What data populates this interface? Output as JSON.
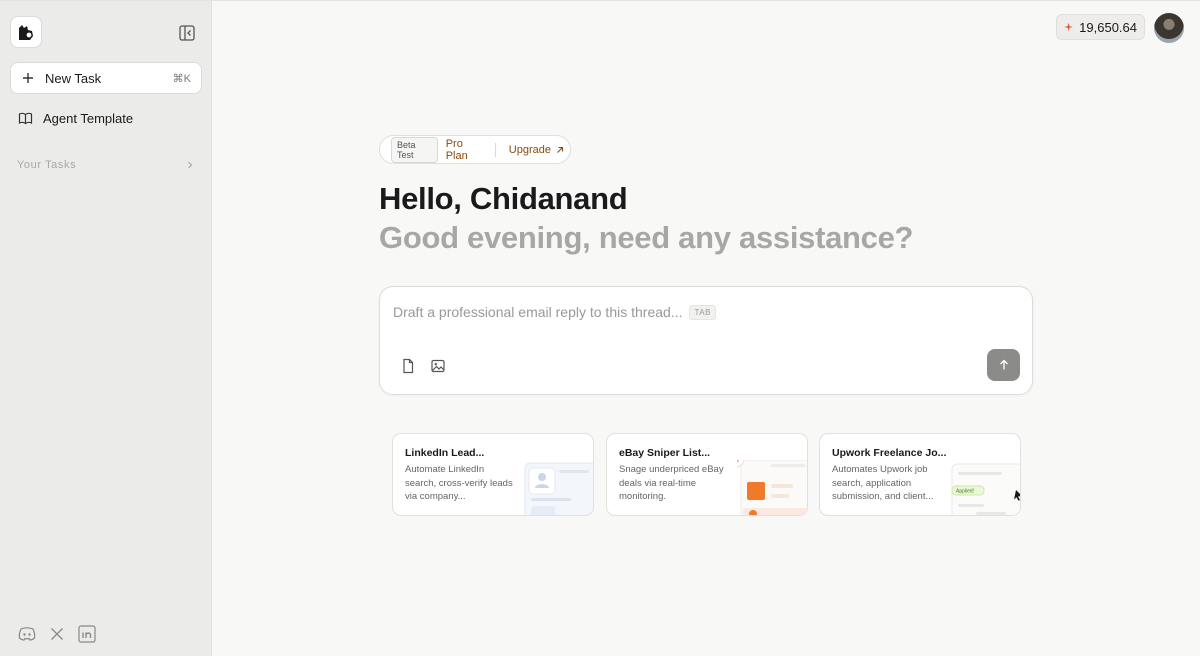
{
  "sidebar": {
    "new_task_label": "New Task",
    "new_task_shortcut": "⌘K",
    "agent_template_label": "Agent Template",
    "your_tasks_label": "Your Tasks"
  },
  "header": {
    "credits": "19,650.64"
  },
  "plan": {
    "beta_label": "Beta Test",
    "plan_label": "Pro Plan",
    "upgrade_label": "Upgrade"
  },
  "main": {
    "greeting": "Hello, Chidanand",
    "subgreeting": "Good evening, need any assistance?",
    "composer_placeholder": "Draft a professional email reply to this thread...",
    "tab_hint": "TAB"
  },
  "cards": [
    {
      "title": "LinkedIn Lead...",
      "description": "Automate LinkedIn search, cross-verify leads via company..."
    },
    {
      "title": "eBay Sniper List...",
      "description": "Snage underpriced eBay deals via real-time monitoring."
    },
    {
      "title": "Upwork Freelance Jo...",
      "description": "Automates Upwork job search, application submission, and client..."
    }
  ],
  "card_thumbs": {
    "ebay_badge": "%",
    "upwork_badge": "Applied!"
  },
  "colors": {
    "accent": "#8a4a10",
    "credit_star": "#e0593a",
    "sidebar_bg": "#ebebea",
    "main_bg": "#f8f8f7"
  },
  "icons": [
    "logo-icon",
    "sidebar-collapse-icon",
    "plus-icon",
    "book-icon",
    "chevron-right-icon",
    "discord-icon",
    "x-icon",
    "linkedin-icon",
    "sparkle-icon",
    "arrow-up-right-icon",
    "file-icon",
    "image-icon",
    "arrow-up-icon"
  ]
}
